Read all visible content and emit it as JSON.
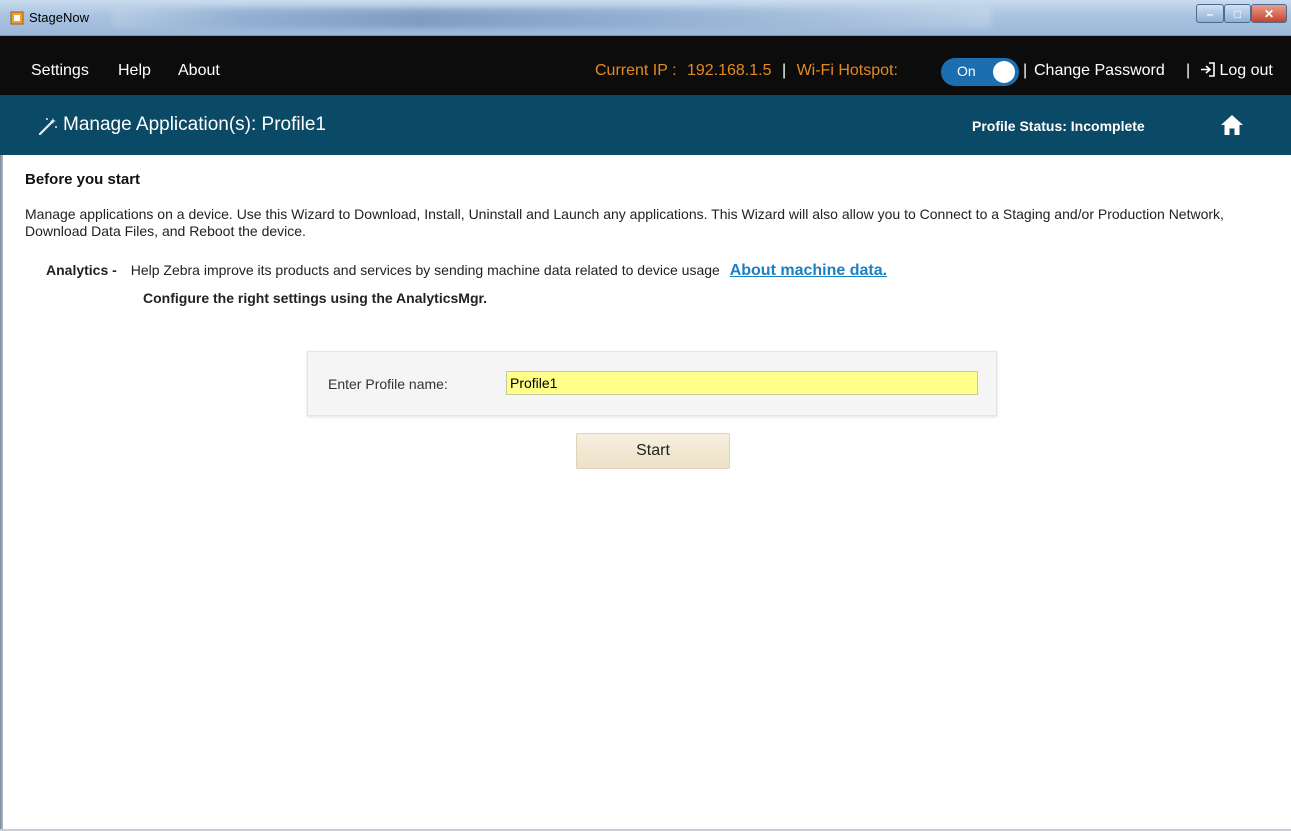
{
  "window": {
    "title": "StageNow"
  },
  "menubar": {
    "items": [
      "Settings",
      "Help",
      "About"
    ],
    "current_ip_label": "Current IP :",
    "current_ip_value": "192.168.1.5",
    "separator": "|",
    "wifi_hotspot_label": "Wi-Fi Hotspot:",
    "wifi_hotspot_state": "On",
    "change_password": "Change Password",
    "logout": "Log out"
  },
  "header": {
    "title": "Manage Application(s): Profile1",
    "profile_status": "Profile Status: Incomplete"
  },
  "content": {
    "heading": "Before you start",
    "description": "Manage applications on a device.  Use this Wizard to Download, Install, Uninstall and Launch any applications.  This Wizard will also allow you to Connect to a Staging and/or Production Network, Download Data Files, and Reboot the device.",
    "analytics_label": "Analytics -",
    "analytics_text": "Help Zebra improve its products and services by sending machine data related to device usage",
    "analytics_link": "About machine data.",
    "configure_text": "Configure the right settings using the AnalyticsMgr.",
    "profile_name_label": "Enter Profile name:",
    "profile_name_value": "Profile1",
    "start_label": "Start"
  },
  "colors": {
    "menubar_bg": "#0c0c0c",
    "header_bg": "#0b4a66",
    "accent_orange": "#e58a1e",
    "toggle_blue": "#1b6fb0",
    "link_blue": "#1b7fc1",
    "input_highlight": "#ffff8a"
  },
  "icons": [
    "app-icon",
    "wand-icon",
    "home-icon",
    "logout-icon",
    "minimize-icon",
    "maximize-icon",
    "close-icon"
  ]
}
